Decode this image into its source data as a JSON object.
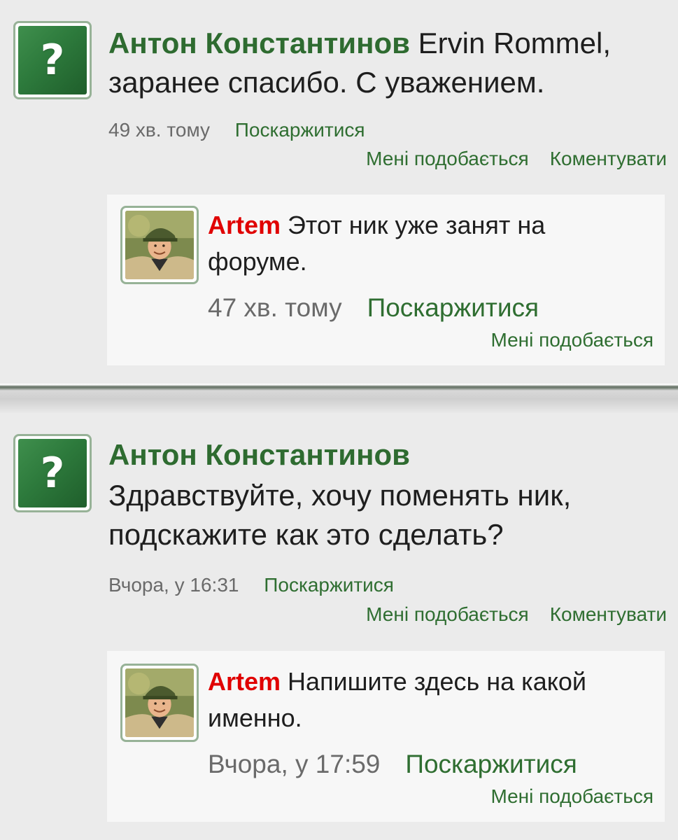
{
  "comments": [
    {
      "author": "Антон Константинов",
      "text": "Ervin Rommel, заранее спасибо. С уважением.",
      "time": "49 хв. тому",
      "report": "Поскаржитися",
      "like": "Мені подобається",
      "comment": "Коментувати",
      "avatar_icon": "question-mark-icon",
      "reply": {
        "author": "Artem",
        "text": "Этот ник уже занят на форуме.",
        "time": "47 хв. тому",
        "report": "Поскаржитися",
        "like": "Мені подобається"
      }
    },
    {
      "author": "Антон Константинов",
      "text": "Здравствуйте, хочу поменять ник, подскажите как это сделать?",
      "time": "Вчора, у 16:31",
      "report": "Поскаржитися",
      "like": "Мені подобається",
      "comment": "Коментувати",
      "avatar_icon": "question-mark-icon",
      "reply": {
        "author": "Artem",
        "text": "Напишите здесь на какой именно.",
        "time": "Вчора, у 17:59",
        "report": "Поскаржитися",
        "like": "Мені подобається"
      }
    }
  ],
  "colors": {
    "background": "#ebebeb",
    "author_name": "#2e6b30",
    "link": "#2f6e31",
    "reply_author": "#e00000",
    "meta_time": "#6a6a6a",
    "avatar_green": "#2d7a3c"
  }
}
